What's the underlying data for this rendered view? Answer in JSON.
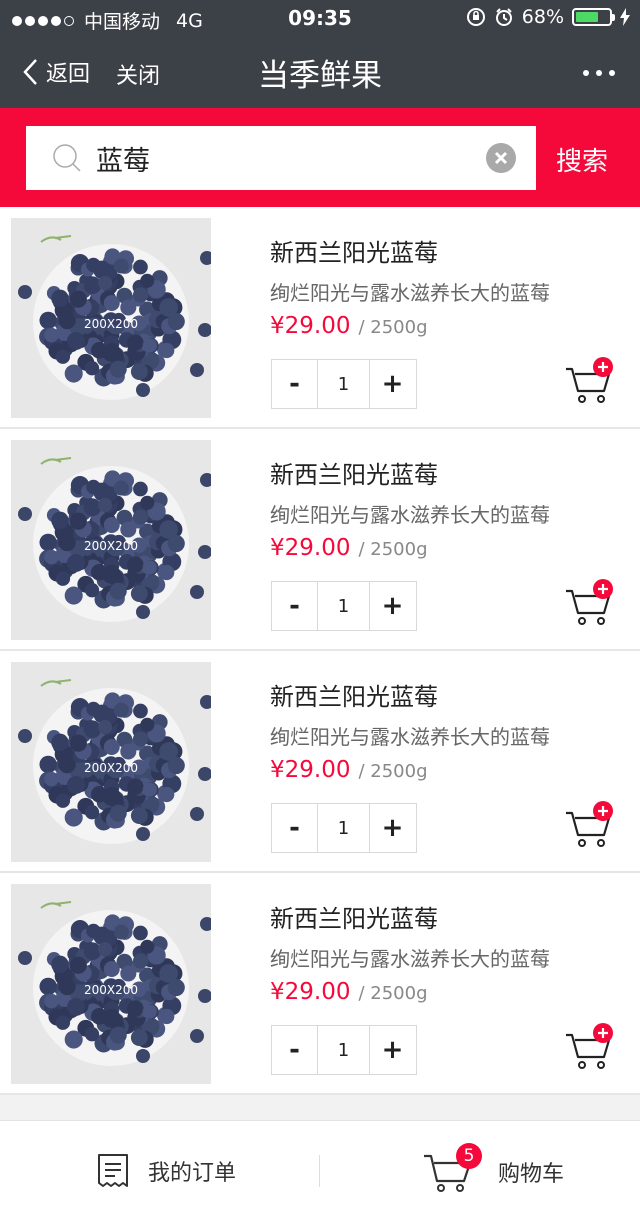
{
  "status_bar": {
    "carrier": "中国移动",
    "network": "4G",
    "time": "09:35",
    "battery": "68%",
    "battery_level": 0.68
  },
  "nav": {
    "back_label": "返回",
    "close_label": "关闭",
    "title": "当季鲜果"
  },
  "search": {
    "value": "蓝莓",
    "button_label": "搜索"
  },
  "products": [
    {
      "image_label": "200X200",
      "name": "新西兰阳光蓝莓",
      "desc": "绚烂阳光与露水滋养长大的蓝莓",
      "price": "¥29.00",
      "unit": "/ 2500g",
      "qty": "1",
      "minus": "-",
      "plus": "+"
    },
    {
      "image_label": "200X200",
      "name": "新西兰阳光蓝莓",
      "desc": "绚烂阳光与露水滋养长大的蓝莓",
      "price": "¥29.00",
      "unit": "/ 2500g",
      "qty": "1",
      "minus": "-",
      "plus": "+"
    },
    {
      "image_label": "200X200",
      "name": "新西兰阳光蓝莓",
      "desc": "绚烂阳光与露水滋养长大的蓝莓",
      "price": "¥29.00",
      "unit": "/ 2500g",
      "qty": "1",
      "minus": "-",
      "plus": "+"
    },
    {
      "image_label": "200X200",
      "name": "新西兰阳光蓝莓",
      "desc": "绚烂阳光与露水滋养长大的蓝莓",
      "price": "¥29.00",
      "unit": "/ 2500g",
      "qty": "1",
      "minus": "-",
      "plus": "+"
    }
  ],
  "footer": {
    "orders_label": "我的订单",
    "cart_label": "购物车",
    "cart_count": "5"
  },
  "colors": {
    "accent": "#f5093a",
    "nav_bg": "#3c4047"
  }
}
